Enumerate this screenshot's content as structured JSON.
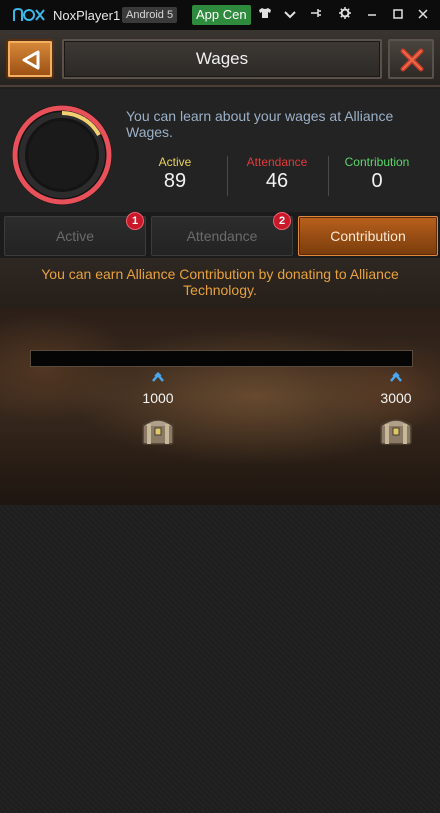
{
  "emulator": {
    "app_name": "NoxPlayer1",
    "android_version": "Android 5",
    "app_center_label": "App Cen"
  },
  "header": {
    "title": "Wages"
  },
  "summary": {
    "info_text": "You can learn about your wages at Alliance Wages.",
    "stats": [
      {
        "label": "Active",
        "value": "89",
        "color": "#e8d25a"
      },
      {
        "label": "Attendance",
        "value": "46",
        "color": "#e23a3a"
      },
      {
        "label": "Contribution",
        "value": "0",
        "color": "#5ad86a"
      }
    ],
    "ring_colors": {
      "main": "#e8505a",
      "highlight": "#f0d070"
    }
  },
  "tabs": [
    {
      "label": "Active",
      "badge": "1",
      "selected": false
    },
    {
      "label": "Attendance",
      "badge": "2",
      "selected": false
    },
    {
      "label": "Contribution",
      "badge": "",
      "selected": true
    }
  ],
  "contribution": {
    "message": "You can earn Alliance Contribution by donating to Alliance Technology.",
    "progress": 0,
    "milestones": [
      {
        "value": "1000"
      },
      {
        "value": "3000"
      }
    ]
  }
}
